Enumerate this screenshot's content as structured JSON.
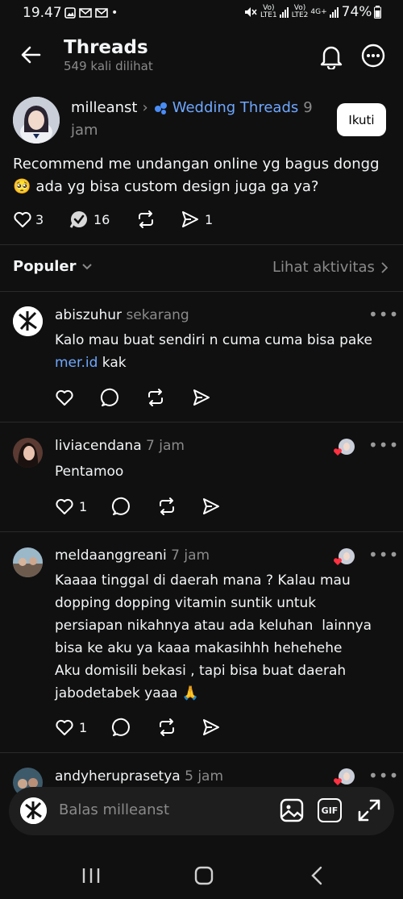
{
  "status": {
    "time": "19.47",
    "sim1": "Vo)\nLTE1",
    "sim2": "Vo)\nLTE2",
    "net": "4G+",
    "battery": "74%"
  },
  "header": {
    "title": "Threads",
    "subtitle": "549 kali dilihat"
  },
  "post": {
    "author": "milleanst",
    "community": "Wedding Threads",
    "time_a": "9",
    "time_b": "jam",
    "follow_label": "Ikuti",
    "line1": "Recommend me undangan online yg bagus dongg",
    "line2": "ada yg bisa custom design juga ga ya?",
    "emoji": "🥺",
    "likes": "3",
    "comments": "16",
    "shares": "1"
  },
  "sort": {
    "label": "Populer",
    "activity": "Lihat aktivitas"
  },
  "comments": [
    {
      "user": "abiszuhur",
      "time": "sekarang",
      "line1": "Kalo mau buat sendiri n cuma cuma bisa pake",
      "link": "mer.id",
      "after": " kak"
    },
    {
      "user": "liviacendana",
      "time": "7 jam",
      "text": "Pentamoo",
      "likes": "1"
    },
    {
      "user": "meldaanggreani",
      "time": "7 jam",
      "lines": [
        "Kaaaa tinggal di daerah mana ? Kalau mau",
        "dopping dopping vitamin suntik untuk",
        "persiapan nikahnya atau ada keluhan  lainnya",
        "bisa ke aku ya kaaa makasihhh hehehehe",
        "Aku domisili bekasi , tapi bisa buat daerah",
        "jabodetabek yaaa 🙏"
      ],
      "likes": "1"
    },
    {
      "user": "andyheruprasetya",
      "time": "5 jam"
    }
  ],
  "reply": {
    "placeholder": "Balas milleanst",
    "gif": "GIF"
  },
  "icons": [
    "back-arrow-icon",
    "bell-icon",
    "more-circle-icon",
    "heart-icon",
    "comment-check-icon",
    "repost-icon",
    "send-icon",
    "chevron-down-icon",
    "chevron-right-icon",
    "image-icon",
    "gif-icon",
    "expand-icon",
    "nav-recents-icon",
    "nav-home-icon",
    "nav-back-icon"
  ]
}
